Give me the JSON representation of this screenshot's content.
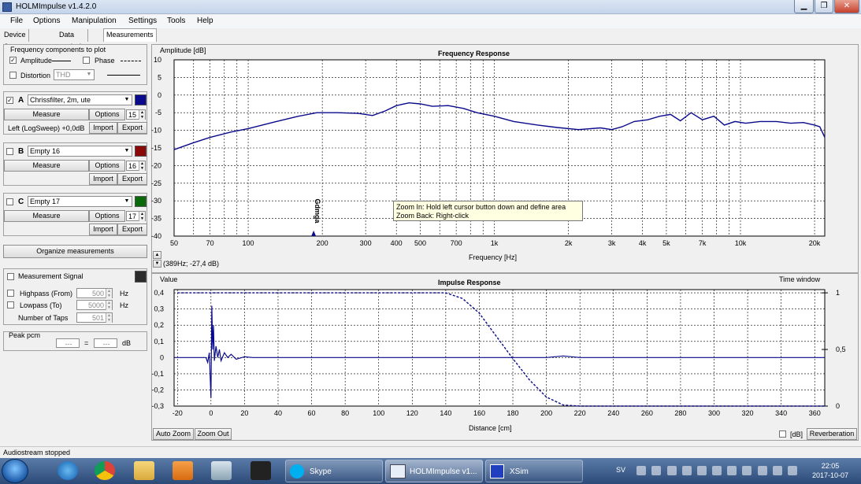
{
  "window": {
    "title": "HOLMImpulse  v1.4.2.0"
  },
  "menu": [
    "File",
    "Options",
    "Manipulation",
    "Settings",
    "Tools",
    "Help"
  ],
  "tabs": [
    "Device & Signal",
    "Data analysis",
    "Measurements"
  ],
  "components": {
    "title": "Frequency components to plot",
    "amplitude": "Amplitude",
    "phase": "Phase",
    "distortion": "Distortion",
    "distortion_type": "THD"
  },
  "measurements": [
    {
      "letter": "A",
      "name": "Chrissfilter, 2m, ute",
      "number": "15",
      "color": "#0a0a8c",
      "checked": true,
      "info": "Left (LogSweep) +0,0dB"
    },
    {
      "letter": "B",
      "name": "Empty 16",
      "number": "16",
      "color": "#8a0a0a",
      "checked": false,
      "info": ""
    },
    {
      "letter": "C",
      "name": "Empty 17",
      "number": "17",
      "color": "#0a6a0a",
      "checked": false,
      "info": ""
    }
  ],
  "buttons": {
    "measure": "Measure",
    "options": "Options",
    "import": "Import",
    "export": "Export",
    "organize": "Organize measurements",
    "auto_zoom": "Auto Zoom",
    "zoom_out": "Zoom Out",
    "reverberation": "Reverberation",
    "db": "[dB]"
  },
  "signal": {
    "title": "Measurement Signal",
    "highpass": "Highpass (From)",
    "highpass_value": "500",
    "lowpass": "Lowpass (To)",
    "lowpass_value": "5000",
    "taps": "Number of Taps",
    "taps_value": "501",
    "hz": "Hz"
  },
  "peak": {
    "title": "Peak pcm",
    "value1": "---",
    "value2": "---",
    "eq": "=",
    "unit": "dB"
  },
  "freq_chart": {
    "title": "Frequency Response",
    "ylabel": "Amplitude [dB]",
    "xlabel": "Frequency [Hz]",
    "cursor": "(389Hz; -27,4 dB)",
    "marker": "Gdmga"
  },
  "impulse_chart": {
    "title": "Impulse Response",
    "ylabel": "Value",
    "y2label": "Time window",
    "xlabel": "Distance [cm]"
  },
  "tooltip": {
    "line1": "Zoom In:   Hold left cursor button down and define area",
    "line2": "Zoom Back: Right-click"
  },
  "status": "Audiostream stopped",
  "taskbar": {
    "tasks": [
      "Skype",
      "HOLMImpulse  v1...",
      "XSim"
    ],
    "lang": "SV",
    "time": "22:05",
    "date": "2017-10-07"
  },
  "chart_data": [
    {
      "type": "line",
      "title": "Frequency Response",
      "xlabel": "Frequency [Hz]",
      "ylabel": "Amplitude [dB]",
      "xscale": "log",
      "xlim": [
        50,
        22000
      ],
      "ylim": [
        -40,
        10
      ],
      "xticks": [
        50,
        70,
        100,
        200,
        300,
        400,
        500,
        700,
        1000,
        2000,
        3000,
        4000,
        5000,
        7000,
        10000,
        20000
      ],
      "xticklabels": [
        "50",
        "70",
        "100",
        "200",
        "300",
        "400",
        "500",
        "700",
        "1k",
        "2k",
        "3k",
        "4k",
        "5k",
        "7k",
        "10k",
        "20k"
      ],
      "yticks": [
        10,
        5,
        0,
        -5,
        -10,
        -15,
        -20,
        -25,
        -30,
        -35,
        -40
      ],
      "grid": true,
      "series": [
        {
          "color": "#0a0a8c",
          "x": [
            50,
            60,
            70,
            85,
            100,
            130,
            160,
            190,
            230,
            280,
            320,
            360,
            400,
            450,
            500,
            560,
            650,
            750,
            850,
            1000,
            1200,
            1500,
            1800,
            2200,
            2700,
            3000,
            3300,
            3700,
            4200,
            4700,
            5200,
            5700,
            6300,
            7000,
            7800,
            8600,
            9500,
            10500,
            12000,
            14000,
            16000,
            18000,
            20000,
            21000,
            22000
          ],
          "y": [
            -15.5,
            -13.5,
            -12,
            -10.5,
            -9.5,
            -7.5,
            -6,
            -5,
            -5,
            -5.2,
            -5.8,
            -4.5,
            -3,
            -2.2,
            -2.5,
            -3.2,
            -3,
            -3.8,
            -5,
            -6,
            -7.5,
            -8.5,
            -9.2,
            -9.8,
            -9.3,
            -9.8,
            -9,
            -7.5,
            -7,
            -6,
            -5.5,
            -7.3,
            -5,
            -7,
            -6,
            -8.5,
            -7.5,
            -8,
            -7.5,
            -7.5,
            -8,
            -7.8,
            -8.5,
            -9,
            -12
          ]
        }
      ]
    },
    {
      "type": "line",
      "title": "Impulse Response",
      "xlabel": "Distance [cm]",
      "ylabel": "Value",
      "y2label": "Time window",
      "xlim": [
        -22,
        366
      ],
      "ylim": [
        -0.3,
        0.42
      ],
      "xticks": [
        -20,
        0,
        20,
        40,
        60,
        80,
        100,
        120,
        140,
        160,
        180,
        200,
        220,
        240,
        260,
        280,
        300,
        320,
        340,
        360
      ],
      "yticks": [
        0.4,
        0.3,
        0.2,
        0.1,
        0,
        -0.1,
        -0.2,
        -0.3
      ],
      "yticklabels": [
        "0,4",
        "0,3",
        "0,2",
        "0,1",
        "0",
        "-0,1",
        "-0,2",
        "-0,3"
      ],
      "y2ticks": [
        1,
        0.5,
        0
      ],
      "y2ticklabels": [
        "1",
        "0,5",
        "0"
      ],
      "grid": true,
      "series": [
        {
          "name": "Impulse",
          "color": "#0a0a8c",
          "x": [
            -22,
            -3,
            -2,
            -1,
            0,
            0.5,
            1,
            1.5,
            2,
            3,
            4,
            5,
            6,
            8,
            10,
            12,
            15,
            20,
            25,
            30,
            200,
            210,
            220,
            230,
            366
          ],
          "y": [
            0,
            0,
            -0.03,
            0.03,
            -0.25,
            0.32,
            0.05,
            0.2,
            -0.02,
            0.07,
            0.0,
            0.05,
            -0.02,
            0.03,
            0.0,
            0.02,
            -0.01,
            0.005,
            0,
            0,
            0,
            0.01,
            0,
            0,
            0
          ]
        },
        {
          "name": "Time window",
          "color": "#0a0a8c",
          "dashed": true,
          "axis": "y2",
          "x": [
            -20,
            0,
            140,
            150,
            160,
            170,
            180,
            190,
            200,
            210,
            220,
            366
          ],
          "y": [
            1,
            1,
            1,
            0.95,
            0.82,
            0.62,
            0.42,
            0.23,
            0.08,
            0.01,
            0,
            0
          ]
        }
      ]
    }
  ]
}
